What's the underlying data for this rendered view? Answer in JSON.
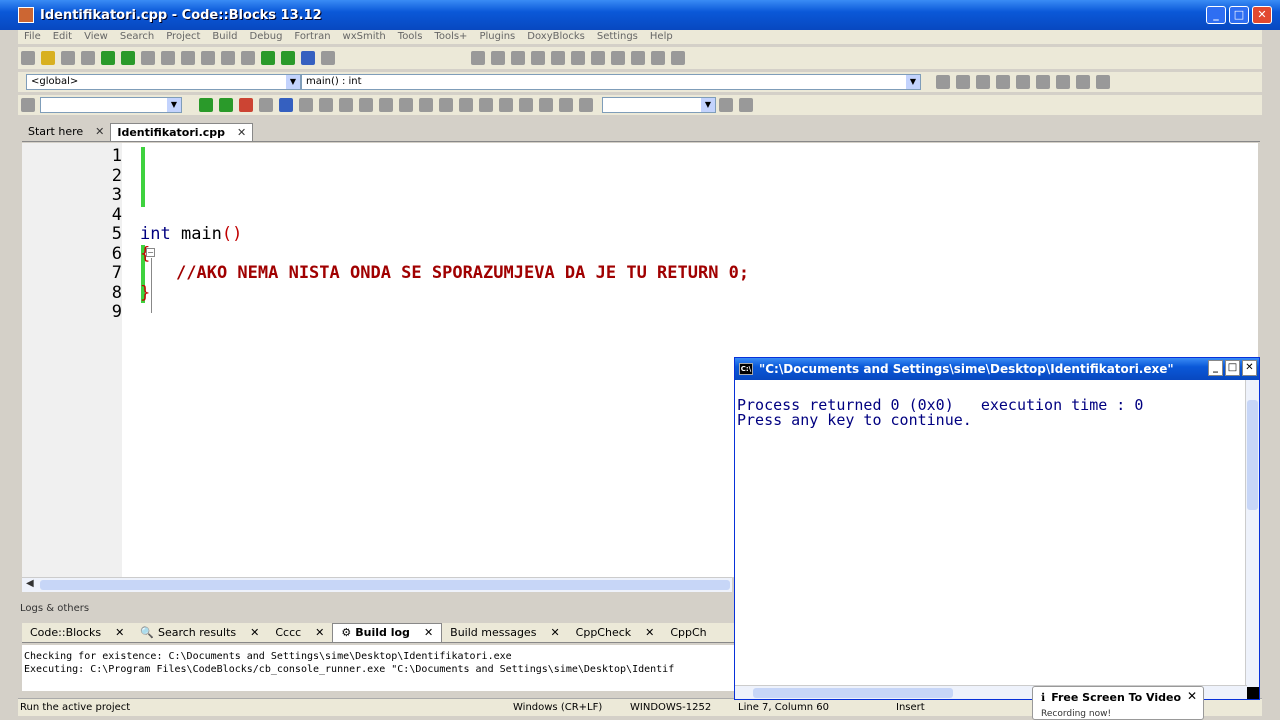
{
  "window": {
    "title": "Identifikatori.cpp - Code::Blocks 13.12",
    "btn_min": "_",
    "btn_max": "□",
    "btn_close": "✕"
  },
  "menu": [
    "File",
    "Edit",
    "View",
    "Search",
    "Project",
    "Build",
    "Debug",
    "Fortran",
    "wxSmith",
    "Tools",
    "Tools+",
    "Plugins",
    "DoxyBlocks",
    "Settings",
    "Help"
  ],
  "scope": {
    "global": "<global>",
    "function": "main() : int"
  },
  "tabs": {
    "start": "Start here",
    "file": "Identifikatori.cpp",
    "close": "✕"
  },
  "editor": {
    "line_numbers": [
      "1",
      "2",
      "3",
      "4",
      "5",
      "6",
      "7",
      "8",
      "9"
    ],
    "line5_kw": "int",
    "line5_rest": " main",
    "line5_parens": "()",
    "line6_brace": "{",
    "line7_comment": "//AKO NEMA NISTA ONDA SE SPORAZUMJEVA DA JE TU RETURN 0;",
    "line8_brace": "}",
    "fold_marker": "−"
  },
  "logs": {
    "panel_title": "Logs & others",
    "tabs": {
      "codeblocks": "Code::Blocks",
      "search": "Search results",
      "cccc": "Cccc",
      "build_log": "Build log",
      "build_messages": "Build messages",
      "cppcheck": "CppCheck",
      "cppcheck2": "CppCh"
    },
    "close": "✕",
    "lines": [
      "Checking for existence: C:\\Documents and Settings\\sime\\Desktop\\Identifikatori.exe",
      "Executing: C:\\Program Files\\CodeBlocks/cb_console_runner.exe \"C:\\Documents and Settings\\sime\\Desktop\\Identif"
    ]
  },
  "status": {
    "message": "Run the active project",
    "eol": "Windows (CR+LF)",
    "encoding": "WINDOWS-1252",
    "position": "Line 7, Column 60",
    "mode": "Insert"
  },
  "console": {
    "title": "\"C:\\Documents and Settings\\sime\\Desktop\\Identifikatori.exe\"",
    "line1": "Process returned 0 (0x0)   execution time : 0",
    "line2": "Press any key to continue.",
    "icon_label": "C:\\"
  },
  "recorder": {
    "title": "Free Screen To Video",
    "subtitle": "Recording now!",
    "close": "✕"
  }
}
